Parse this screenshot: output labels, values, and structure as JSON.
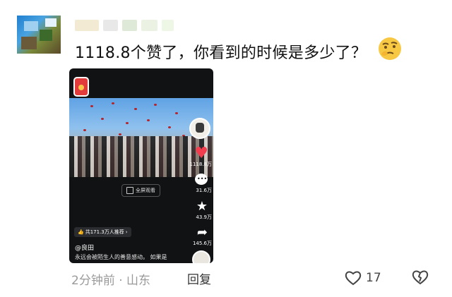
{
  "comment": {
    "username": "",
    "text": "1118.8个赞了，你看到的时候是多少了？",
    "emoji": "thinking-face-emoji"
  },
  "video_card": {
    "fullscreen_label": "全屏观看",
    "recommend_label": "共171.3万人推荐",
    "author": "@良田",
    "caption": "永远会被陌生人的善意感动。 如果是",
    "stats": {
      "likes": "1118.8万",
      "comments": "31.6万",
      "favorites": "43.9万",
      "shares": "145.6万"
    }
  },
  "meta": {
    "time": "2分钟前",
    "separator": "·",
    "location": "山东",
    "reply_label": "回复",
    "like_count": "17"
  },
  "colors": {
    "accent_red": "#f23d4f",
    "meta_gray": "#9a9a9a"
  }
}
